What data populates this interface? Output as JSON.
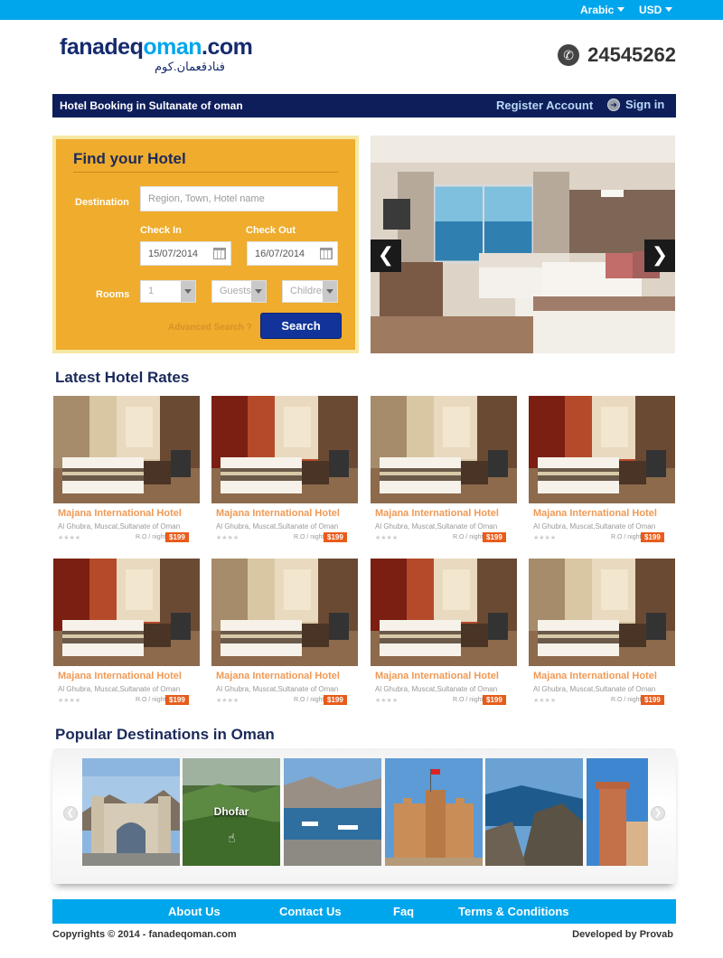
{
  "topbar": {
    "language": "Arabic",
    "currency": "USD"
  },
  "header": {
    "logo_part1": "fanadeq",
    "logo_part2": "oman",
    "logo_part3": ".com",
    "logo_arabic": "فنادقعمان.كوم",
    "phone": "24545262",
    "phone_icon": "phone-icon"
  },
  "nav": {
    "tagline": "Hotel Booking in Sultanate of oman",
    "register": "Register Account",
    "signin": "Sign in"
  },
  "search": {
    "title": "Find your Hotel",
    "destination_label": "Destination",
    "destination_placeholder": "Region, Town, Hotel name",
    "checkin_label": "Check In",
    "checkin_value": "15/07/2014",
    "checkout_label": "Check Out",
    "checkout_value": "16/07/2014",
    "rooms_label": "Rooms",
    "rooms_value": "1",
    "guests_value": "Guests",
    "children_value": "Children",
    "advanced": "Advanced Search ?",
    "button": "Search"
  },
  "hero": {
    "prev": "❮",
    "next": "❯"
  },
  "latest": {
    "title": "Latest Hotel Rates",
    "hotels": [
      {
        "name": "Majana International Hotel",
        "location": "Al Ghubra, Muscat,Sultanate of Oman",
        "stars": "★★★★",
        "unit": "R.O / night",
        "price": "$199"
      },
      {
        "name": "Majana International Hotel",
        "location": "Al Ghubra, Muscat,Sultanate of Oman",
        "stars": "★★★★",
        "unit": "R.O / night",
        "price": "$199"
      },
      {
        "name": "Majana International Hotel",
        "location": "Al Ghubra, Muscat,Sultanate of Oman",
        "stars": "★★★★",
        "unit": "R.O / night",
        "price": "$199"
      },
      {
        "name": "Majana International Hotel",
        "location": "Al Ghubra, Muscat,Sultanate of Oman",
        "stars": "★★★★",
        "unit": "R.O / night",
        "price": "$199"
      },
      {
        "name": "Majana International Hotel",
        "location": "Al Ghubra, Muscat,Sultanate of Oman",
        "stars": "★★★★",
        "unit": "R.O / night",
        "price": "$199"
      },
      {
        "name": "Majana International Hotel",
        "location": "Al Ghubra, Muscat,Sultanate of Oman",
        "stars": "★★★★",
        "unit": "R.O / night",
        "price": "$199"
      },
      {
        "name": "Majana International Hotel",
        "location": "Al Ghubra, Muscat,Sultanate of Oman",
        "stars": "★★★★",
        "unit": "R.O / night",
        "price": "$199"
      },
      {
        "name": "Majana International Hotel",
        "location": "Al Ghubra, Muscat,Sultanate of Oman",
        "stars": "★★★★",
        "unit": "R.O / night",
        "price": "$199"
      }
    ]
  },
  "destinations": {
    "title": "Popular Destinations in Oman",
    "hover_label": "Dhofar",
    "prev": "❮",
    "next": "❯"
  },
  "footer": {
    "about": "About Us",
    "contact": "Contact Us",
    "faq": "Faq",
    "terms": "Terms & Conditions",
    "copyright": "Copyrights © 2014 - fanadeqoman.com",
    "developer": "Developed by Provab"
  }
}
